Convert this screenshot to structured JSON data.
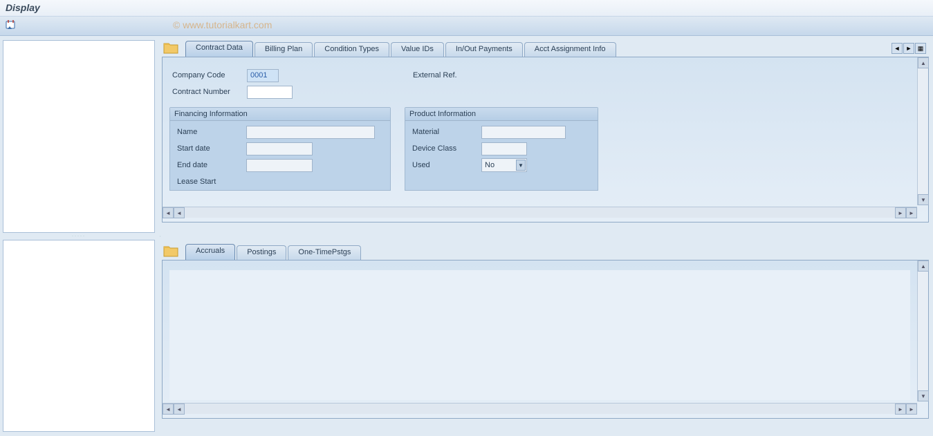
{
  "window_title": "Display",
  "watermark": "© www.tutorialkart.com",
  "upper_tabs": {
    "items": [
      {
        "label": "Contract Data"
      },
      {
        "label": "Billing Plan"
      },
      {
        "label": "Condition Types"
      },
      {
        "label": "Value IDs"
      },
      {
        "label": "In/Out Payments"
      },
      {
        "label": "Acct Assignment Info"
      }
    ],
    "active": 0
  },
  "lower_tabs": {
    "items": [
      {
        "label": "Accruals"
      },
      {
        "label": "Postings"
      },
      {
        "label": "One-TimePstgs"
      }
    ],
    "active": 0
  },
  "contract_data": {
    "company_code_label": "Company Code",
    "company_code_value": "0001",
    "contract_number_label": "Contract Number",
    "contract_number_value": "",
    "external_ref_label": "External Ref.",
    "financing_title": "Financing Information",
    "financing": {
      "name_label": "Name",
      "name_value": "",
      "start_label": "Start date",
      "start_value": "",
      "end_label": "End date",
      "end_value": "",
      "lease_label": "Lease Start",
      "lease_value": ""
    },
    "product_title": "Product Information",
    "product": {
      "material_label": "Material",
      "material_value": "",
      "device_label": "Device Class",
      "device_value": "",
      "used_label": "Used",
      "used_value": "No"
    }
  }
}
